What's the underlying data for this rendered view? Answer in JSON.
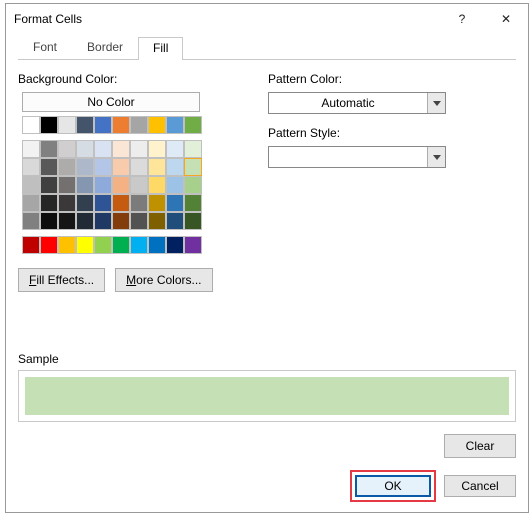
{
  "window": {
    "title": "Format Cells",
    "help": "?",
    "close": "✕"
  },
  "tabs": {
    "font": "Font",
    "border": "Border",
    "fill": "Fill"
  },
  "fill": {
    "bg_label": "Background Color:",
    "no_color": "No Color",
    "fill_effects": "ill Effects...",
    "fill_effects_u": "F",
    "more_colors": "ore Colors...",
    "more_colors_u": "M"
  },
  "pattern": {
    "color_label": "Pattern Color:",
    "color_value": "Automatic",
    "style_label": "Pattern Style:",
    "style_value": ""
  },
  "sample": {
    "label": "Sample",
    "color": "#c5e0b4"
  },
  "buttons": {
    "clear": "Clear",
    "ok": "OK",
    "cancel": "Cancel"
  },
  "swatches": {
    "row1": [
      "#ffffff",
      "#000000",
      "#e7e6e6",
      "#44546a",
      "#4472c4",
      "#ed7d31",
      "#a5a5a5",
      "#ffc000",
      "#5b9bd5",
      "#70ad47"
    ],
    "theme": [
      [
        "#f2f2f2",
        "#808080",
        "#d0cece",
        "#d6dce4",
        "#d9e2f3",
        "#fbe5d5",
        "#ededed",
        "#fff2cc",
        "#deebf6",
        "#e2efd9"
      ],
      [
        "#d9d9d9",
        "#595959",
        "#aeabab",
        "#adb9ca",
        "#b4c6e7",
        "#f7cbac",
        "#dbdbdb",
        "#fee599",
        "#bdd7ee",
        "#c5e0b4"
      ],
      [
        "#bfbfbf",
        "#404040",
        "#757070",
        "#8496b0",
        "#8eaadb",
        "#f4b183",
        "#c9c9c9",
        "#ffd965",
        "#9cc3e5",
        "#a8d08d"
      ],
      [
        "#a6a6a6",
        "#262626",
        "#3a3838",
        "#323f4f",
        "#2f5496",
        "#c55a11",
        "#7b7b7b",
        "#bf9000",
        "#2e75b5",
        "#538135"
      ],
      [
        "#808080",
        "#0d0d0d",
        "#171616",
        "#222a35",
        "#1f3864",
        "#833c0b",
        "#525252",
        "#7f6000",
        "#1e4e79",
        "#375623"
      ]
    ],
    "standard": [
      "#c00000",
      "#ff0000",
      "#ffc000",
      "#ffff00",
      "#92d050",
      "#00b050",
      "#00b0f0",
      "#0070c0",
      "#002060",
      "#7030a0"
    ]
  }
}
